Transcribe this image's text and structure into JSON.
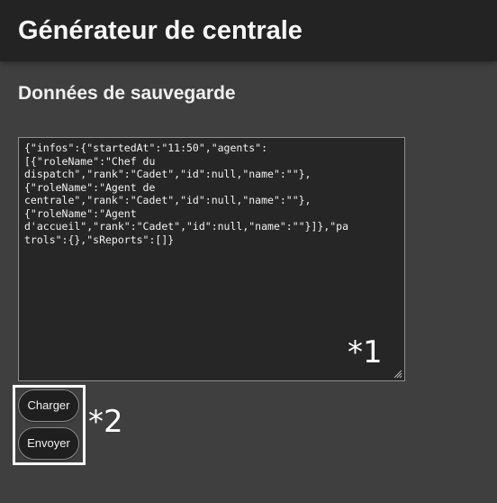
{
  "header": {
    "title": "Générateur de centrale"
  },
  "save_section": {
    "title": "Données de sauvegarde",
    "textarea_value": "{\"infos\":{\"startedAt\":\"11:50\",\"agents\":[{\"roleName\":\"Chef du dispatch\",\"rank\":\"Cadet\",\"id\":null,\"name\":\"\"},{\"roleName\":\"Agent de centrale\",\"rank\":\"Cadet\",\"id\":null,\"name\":\"\"},{\"roleName\":\"Agent d'accueil\",\"rank\":\"Cadet\",\"id\":null,\"name\":\"\"}]},\"patrols\":{},\"sReports\":[]}",
    "textarea_display": "{\"infos\":{\"startedAt\":\"11:50\",\"agents\":\n[{\"roleName\":\"Chef du\ndispatch\",\"rank\":\"Cadet\",\"id\":null,\"name\":\"\"},\n{\"roleName\":\"Agent de\ncentrale\",\"rank\":\"Cadet\",\"id\":null,\"name\":\"\"},\n{\"roleName\":\"Agent\nd'accueil\",\"rank\":\"Cadet\",\"id\":null,\"name\":\"\"}]},\"pa\ntrols\":{},\"sReports\":[]}"
  },
  "buttons": {
    "load_label": "Charger",
    "send_label": "Envoyer"
  },
  "annotations": {
    "marker_1": "*1",
    "marker_2": "*2"
  },
  "colors": {
    "page_background": "#3f3f3f",
    "header_background": "#232323",
    "textarea_background": "#262626",
    "highlight_border": "#ffffff"
  }
}
